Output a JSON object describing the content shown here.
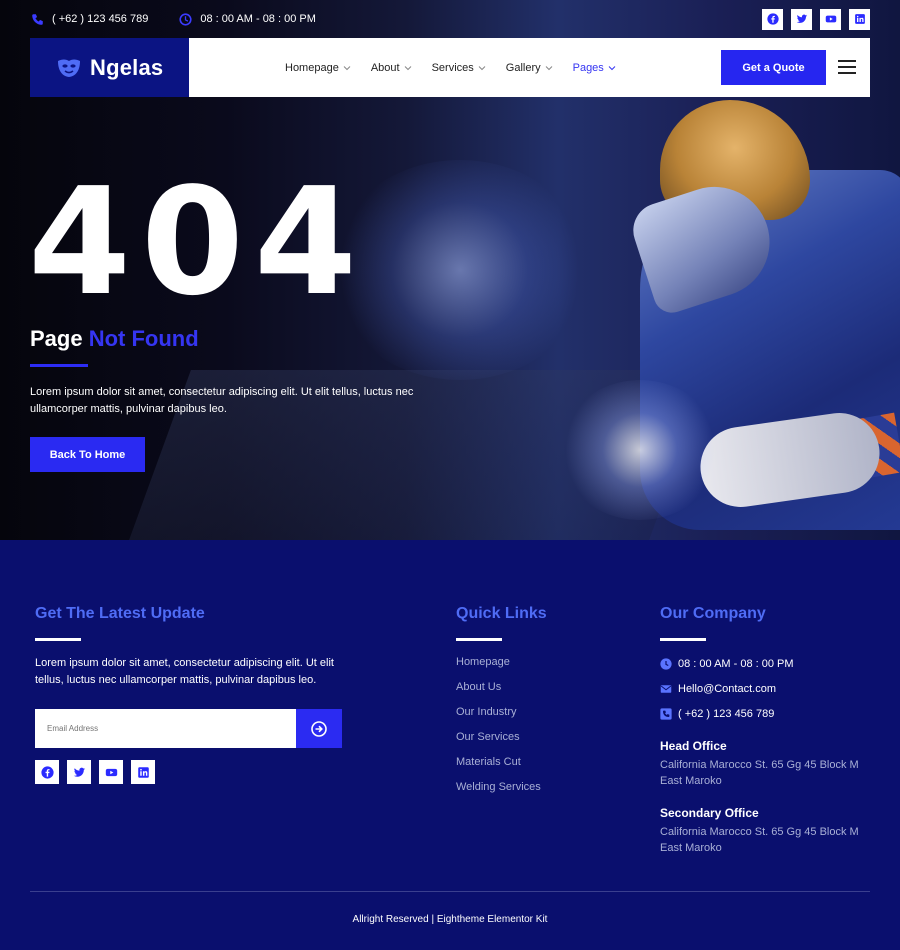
{
  "topbar": {
    "phone": "( +62 ) 123 456 789",
    "hours": "08 : 00 AM - 08 : 00 PM",
    "phone_icon": "phone-icon",
    "clock_icon": "clock-icon",
    "socials": [
      "facebook-icon",
      "twitter-icon",
      "youtube-icon",
      "linkedin-icon"
    ]
  },
  "nav": {
    "logo_text": "Ngelas",
    "items": [
      {
        "label": "Homepage"
      },
      {
        "label": "About"
      },
      {
        "label": "Services"
      },
      {
        "label": "Gallery"
      },
      {
        "label": "Pages"
      }
    ],
    "active": "Pages",
    "quote_label": "Get a Quote"
  },
  "hero": {
    "code": "404",
    "title_plain": "Page ",
    "title_highlight": "Not Found",
    "text": "Lorem ipsum dolor sit amet, consectetur adipiscing elit. Ut elit tellus, luctus nec ullamcorper mattis, pulvinar dapibus leo.",
    "button_label": "Back To Home"
  },
  "footer": {
    "update": {
      "heading": "Get The Latest Update",
      "text": "Lorem ipsum dolor sit amet, consectetur adipiscing elit. Ut elit tellus, luctus nec ullamcorper mattis, pulvinar dapibus leo.",
      "email_placeholder": "Email Address"
    },
    "quick_links": {
      "heading": "Quick Links",
      "items": [
        "Homepage",
        "About Us",
        "Our Industry",
        "Our Services",
        "Materials Cut",
        "Welding Services"
      ]
    },
    "company": {
      "heading": "Our Company",
      "hours": "08 : 00 AM - 08 : 00 PM",
      "email": "Hello@Contact.com",
      "phone": "( +62 ) 123 456 789",
      "head_office_title": "Head Office",
      "head_office_address": "California Marocco St. 65 Gg 45 Block M East Maroko",
      "secondary_office_title": "Secondary Office",
      "secondary_office_address": "California Marocco St. 65 Gg 45 Block M East Maroko"
    },
    "copyright": "Allright Reserved | Eightheme Elementor Kit"
  },
  "colors": {
    "accent": "#2a2af2",
    "footer_bg": "#0a0f6e",
    "heading_blue": "#4f6cf5"
  }
}
